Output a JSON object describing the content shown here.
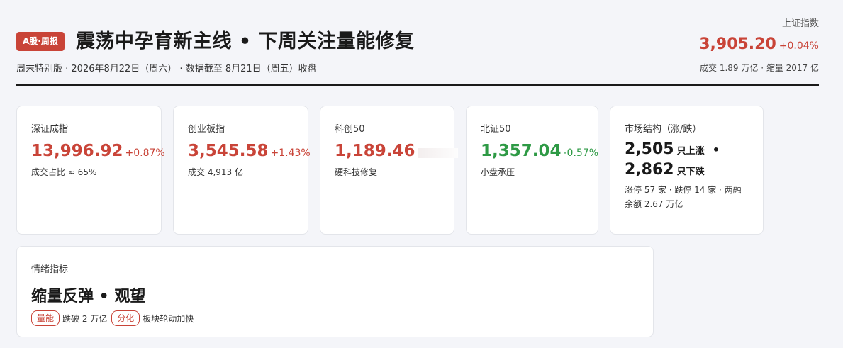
{
  "header": {
    "badge": "A股·周报",
    "title": "震荡中孕育新主线 • 下周关注量能修复",
    "subtitle": "周末特别版 · 2026年8月22日（周六） · 数据截至 8月21日（周五）收盘"
  },
  "main_index": {
    "label": "上证指数",
    "value": "3,905.20",
    "change": "+0.04%",
    "sub": "成交 1.89 万亿 · 缩量 2017 亿"
  },
  "cards": [
    {
      "label": "深证成指",
      "value": "13,996.92",
      "change": "+0.87%",
      "note": "成交占比 ≈ 65%"
    },
    {
      "label": "创业板指",
      "value": "3,545.58",
      "change": "+1.43%",
      "note": "成交 4,913 亿"
    },
    {
      "label": "科创50",
      "value": "1,189.46",
      "note": "硬科技修复"
    },
    {
      "label": "北证50",
      "value": "1,357.04",
      "change": "-0.57%",
      "note": "小盘承压"
    }
  ],
  "structure": {
    "label": "市场结构（涨/跌）",
    "up_count": "2,505",
    "up_unit": "只上涨",
    "sep": "•",
    "down_count": "2,862",
    "down_unit": "只下跌",
    "note": "涨停 57 家 · 跌停 14 家 · 两融余额 2.67 万亿"
  },
  "mood": {
    "label": "情绪指标",
    "headline": "缩量反弹 • 观望",
    "tags": [
      {
        "pill": "量能",
        "text": "跌破 2 万亿"
      },
      {
        "pill": "分化",
        "text": "板块轮动加快"
      }
    ]
  },
  "colors": {
    "up": "#c94438",
    "down": "#2e9a45",
    "accent": "#c94438"
  }
}
